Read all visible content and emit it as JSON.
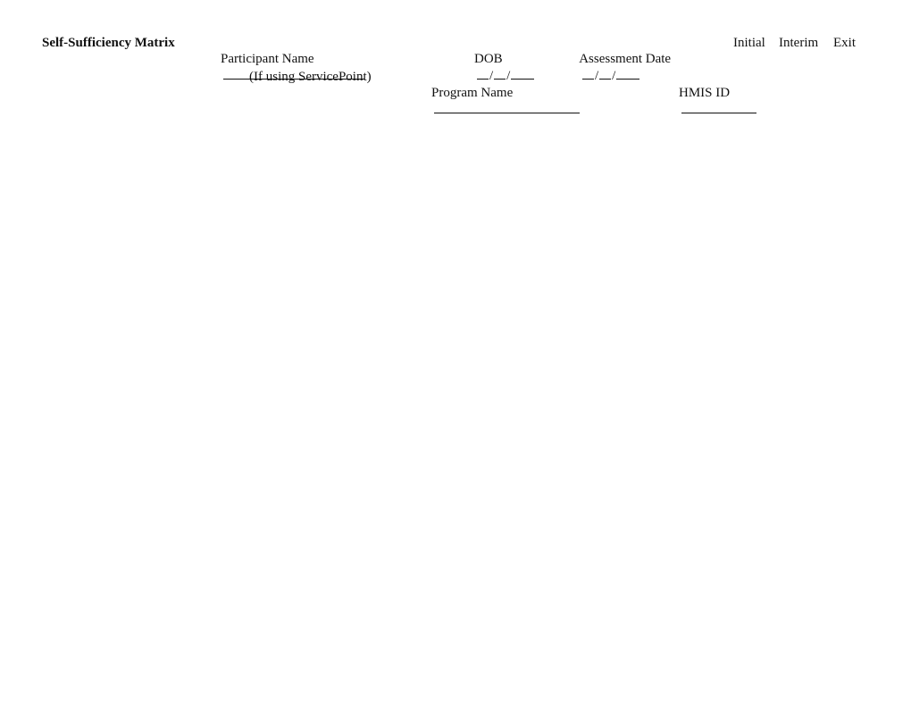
{
  "header": {
    "title": "Self-Sufficiency Matrix",
    "participant_name_label": "Participant Name",
    "dob_label": "DOB",
    "date_separator": "/",
    "assessment_date_label": "Assessment Date",
    "assessment_types": [
      "Initial",
      "Interim",
      "Exit"
    ]
  },
  "subheader": {
    "note": "(If using ServicePoint)",
    "program_name_label": "Program Name",
    "hmis_id_label": "HMIS ID"
  }
}
